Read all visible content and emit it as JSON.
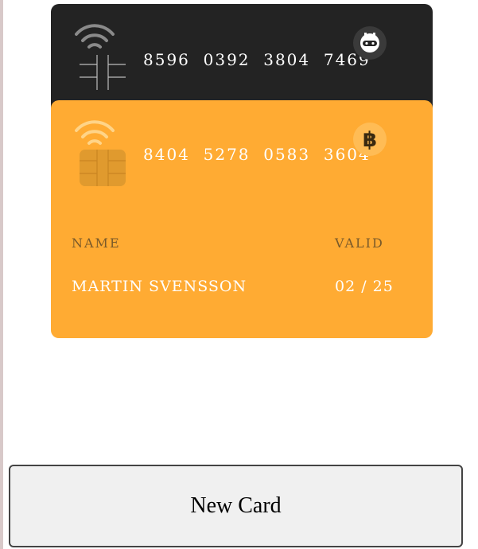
{
  "cards": [
    {
      "number": "8596  0392  3804  7469",
      "brand_icon": "robot-face-icon",
      "color": "#232323"
    },
    {
      "number": "8404  5278  0583  3604",
      "brand_icon": "bitcoin-icon",
      "color": "#ffab33",
      "name_label": "NAME",
      "name_value": "MARTIN SVENSSON",
      "valid_label": "VALID",
      "valid_value": "02 / 25"
    }
  ],
  "actions": {
    "new_card_label": "New Card"
  }
}
